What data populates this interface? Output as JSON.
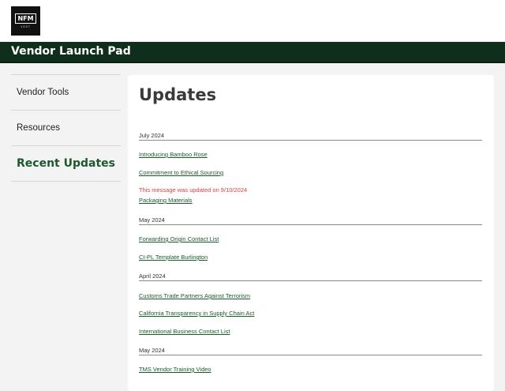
{
  "header": {
    "logo_text": "NFM",
    "logo_sub": "1937"
  },
  "banner": {
    "title": "Vendor Launch Pad"
  },
  "sidebar": {
    "items": [
      {
        "label": "Vendor Tools"
      },
      {
        "label": "Resources"
      },
      {
        "label": "Recent Updates"
      }
    ]
  },
  "main": {
    "title": "Updates",
    "sections": [
      {
        "heading": "July 2024",
        "links": [
          "Introducing Bamboo Rose",
          "Commitment to Ethical Sourcing",
          "Packaging Materials"
        ],
        "note": "This message was updated on 9/10/2024"
      },
      {
        "heading": "May 2024",
        "links": [
          "Forwarding Origin Contact List",
          "CI-PL Template Burlington"
        ]
      },
      {
        "heading": "April 2024",
        "links": [
          "Customs Trade Partners Against Terrorism",
          "California Transparency in Supply Chain Act",
          "International Business Contact List"
        ]
      },
      {
        "heading": "May 2024",
        "links": [
          "TMS Vendor Training Video"
        ]
      }
    ]
  },
  "colors": {
    "banner": "#0f2f1c",
    "accent": "#1a5a2a",
    "note": "#e03a3a"
  }
}
